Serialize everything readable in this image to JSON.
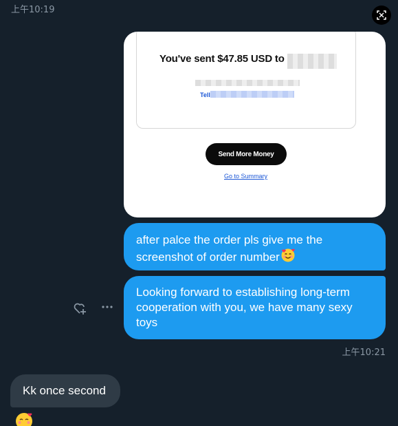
{
  "timestamps": {
    "top": "上午10:19",
    "after_sent": "上午10:21"
  },
  "receipt": {
    "sent_text": "You've sent $47.85 USD to",
    "link_partial": "Tell",
    "send_more_label": "Send More Money",
    "go_to_summary_label": "Go to Summary"
  },
  "messages": [
    {
      "text": "after palce the order pls give me the screenshot of order number",
      "emoji": "smiling-face-with-hearts"
    },
    {
      "text": "Looking forward to establishing long-term cooperation with you, we have many sexy toys"
    },
    {
      "text": "Kk once second"
    }
  ],
  "reaction_emoji": "smiling-face-with-hearts",
  "colors": {
    "background": "#15202b",
    "sent_bubble": "#1d9bf0",
    "received_bubble": "#2f3b46",
    "timestamp": "#8b98a5"
  },
  "icons": {
    "expand": "expand-media-icon",
    "heart_add": "add-reaction-icon",
    "more": "more-options-icon"
  }
}
